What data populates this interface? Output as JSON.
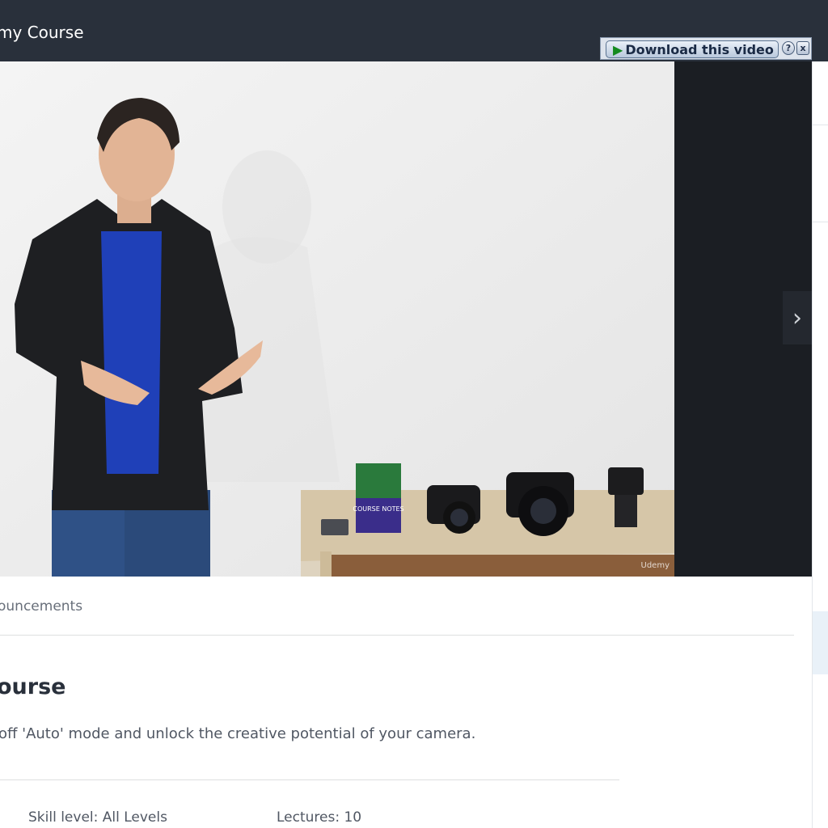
{
  "header": {
    "course_title": "my Course",
    "download_label": "Download this video",
    "help_label": "?",
    "close_label": "x"
  },
  "video": {
    "watermark": "Udemy",
    "book_title": "COURSE NOTES"
  },
  "tabs": {
    "announcements_label": "ouncements"
  },
  "overview": {
    "heading": "ourse",
    "description": "off 'Auto' mode and unlock the creative potential of your camera.",
    "skill_level": "Skill level: All Levels",
    "lectures": "Lectures: 10"
  },
  "colors": {
    "topbar": "#29303b",
    "accent": "#148a1f"
  }
}
